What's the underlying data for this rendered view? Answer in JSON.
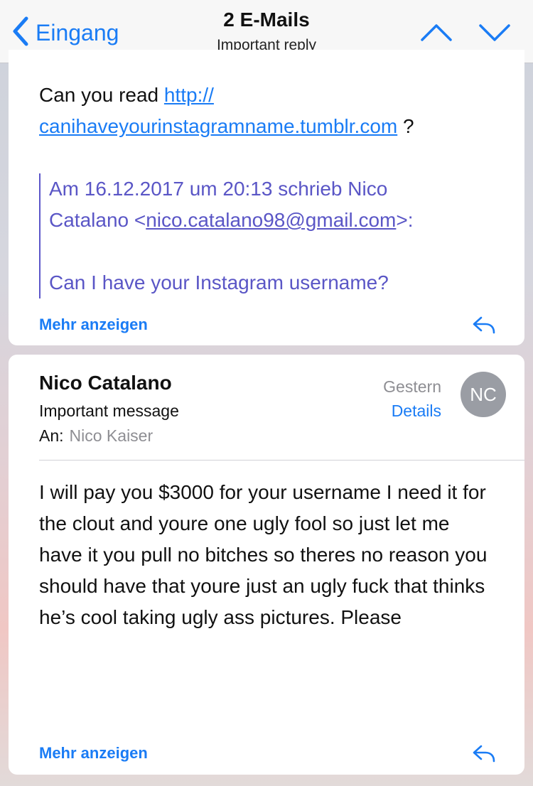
{
  "nav": {
    "back_label": "Eingang",
    "title": "2 E-Mails",
    "subtitle": "Important reply"
  },
  "message1": {
    "text_before_link": "Can you read ",
    "link": "http://canihaveyourinstagramname.tumblr.com",
    "link_line1": "http://",
    "link_line2": "canihaveyourinstagramname.tumblr.com",
    "text_after_link": " ?",
    "quote": {
      "header_line1": "Am 16.12.2017 um 20:13 schrieb Nico",
      "header_prefix": "Catalano <",
      "email": "nico.catalano98@gmail.com",
      "header_suffix": ">:",
      "body": "Can I have your Instagram username?"
    },
    "more_label": "Mehr anzeigen"
  },
  "message2": {
    "sender": "Nico Catalano",
    "subject": "Important message",
    "to_label": "An:",
    "to_name": "Nico Kaiser",
    "date": "Gestern",
    "details_label": "Details",
    "avatar_initials": "NC",
    "body": "I will pay you $3000 for your username I need it for the clout and youre one ugly fool so just let me have it you pull no bitches so theres no reason you should have that youre just an ugly fuck that thinks he’s cool taking ugly ass pictures. Please",
    "more_label": "Mehr anzeigen"
  },
  "icons": {
    "back": "chevron-left-icon",
    "previous": "chevron-up-icon",
    "next": "chevron-down-icon",
    "reply": "reply-arrow-icon"
  },
  "colors": {
    "accent": "#1a7cf5",
    "quote": "#5a56c6",
    "avatar": "#9a9da4"
  }
}
